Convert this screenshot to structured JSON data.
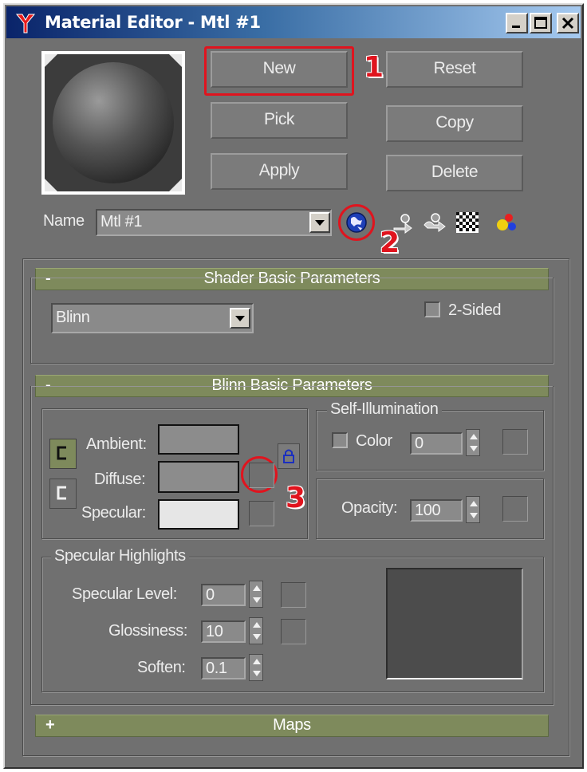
{
  "window": {
    "title": "Material Editor - Mtl #1"
  },
  "buttons": {
    "new": "New",
    "reset": "Reset",
    "pick": "Pick",
    "copy": "Copy",
    "apply": "Apply",
    "delete": "Delete"
  },
  "name_row": {
    "label": "Name",
    "value": "Mtl #1"
  },
  "annotations": [
    "1",
    "2",
    "3"
  ],
  "shader_rollout": {
    "sign": "-",
    "title": "Shader Basic Parameters",
    "shader_value": "Blinn",
    "two_sided_label": "2-Sided"
  },
  "blinn_rollout": {
    "sign": "-",
    "title": "Blinn Basic Parameters",
    "ambient_label": "Ambient:",
    "diffuse_label": "Diffuse:",
    "specular_label": "Specular:",
    "colors": {
      "ambient": "#8c8c8c",
      "diffuse": "#8c8c8c",
      "specular": "#e6e6e6"
    },
    "self_illumination": {
      "title": "Self-Illumination",
      "color_label": "Color",
      "value": "0"
    },
    "opacity": {
      "label": "Opacity:",
      "value": "100"
    },
    "specular_highlights": {
      "title": "Specular Highlights",
      "level_label": "Specular Level:",
      "level_value": "0",
      "glossiness_label": "Glossiness:",
      "glossiness_value": "10",
      "soften_label": "Soften:",
      "soften_value": "0.1"
    }
  },
  "maps_rollout": {
    "sign": "+",
    "title": "Maps"
  }
}
